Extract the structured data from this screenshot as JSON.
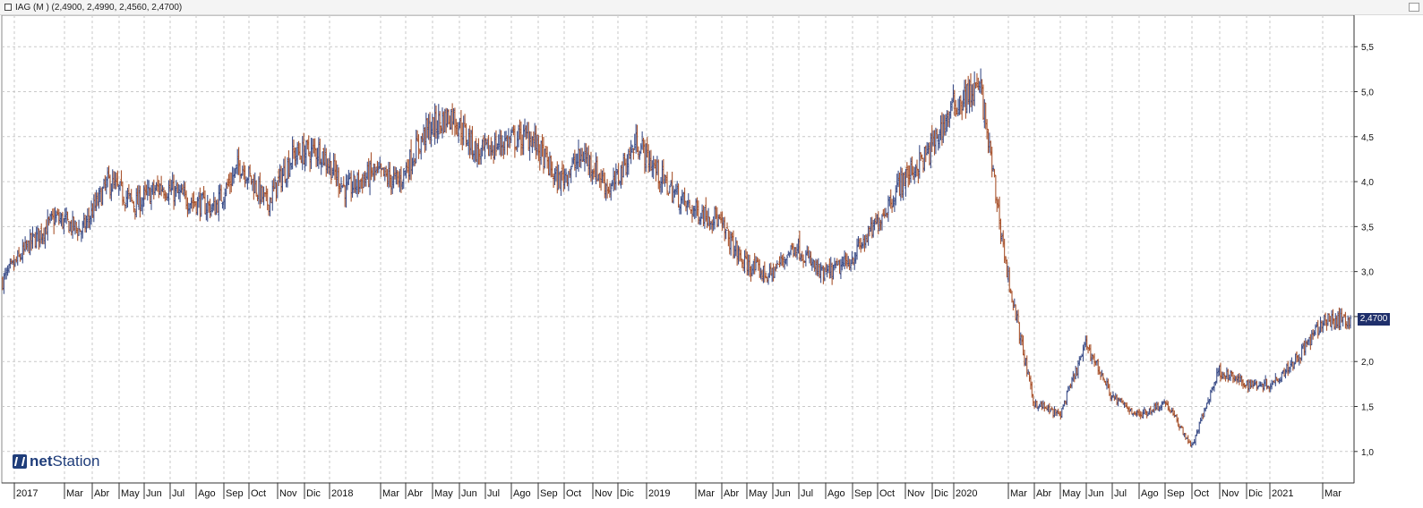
{
  "header": {
    "title": "IAG (M ) (2,4900, 2,4990, 2,4560, 2,4700)"
  },
  "logo": {
    "brand_part1": "net",
    "brand_part2": "Station"
  },
  "price_tag": "2,4700",
  "colors": {
    "up_candle": "#3d4f8a",
    "down_candle": "#a9542e",
    "grid": "#c9c9c9",
    "axis": "#333333",
    "tag_bg": "#1f2f6b"
  },
  "chart_data": {
    "type": "line",
    "style": "bar-ohlc",
    "title": "IAG (M ) (2,4900, 2,4990, 2,4560, 2,4700)",
    "ylim": [
      0.65,
      5.85
    ],
    "yticks": [
      "1,0",
      "1,5",
      "2,0",
      "2,5",
      "3,0",
      "3,5",
      "4,0",
      "4,5",
      "5,0",
      "5,5"
    ],
    "ytick_values": [
      1.0,
      1.5,
      2.0,
      2.5,
      3.0,
      3.5,
      4.0,
      4.5,
      5.0,
      5.5
    ],
    "grid": true,
    "xticks": [
      "2017",
      "Mar",
      "Abr",
      "May",
      "Jun",
      "Jul",
      "Ago",
      "Sep",
      "Oct",
      "Nov",
      "Dic",
      "2018",
      "Mar",
      "Abr",
      "May",
      "Jun",
      "Jul",
      "Ago",
      "Sep",
      "Oct",
      "Nov",
      "Dic",
      "2019",
      "Mar",
      "Abr",
      "May",
      "Jun",
      "Jul",
      "Ago",
      "Sep",
      "Oct",
      "Nov",
      "Dic",
      "2020",
      "Mar",
      "Abr",
      "May",
      "Jun",
      "Jul",
      "Ago",
      "Sep",
      "Oct",
      "Nov",
      "Dic",
      "2021",
      "Mar"
    ],
    "x": [
      "2017-01",
      "2017-02",
      "2017-03",
      "2017-04",
      "2017-05",
      "2017-06",
      "2017-07",
      "2017-08",
      "2017-09",
      "2017-10",
      "2017-11",
      "2017-12",
      "2018-01",
      "2018-02",
      "2018-03",
      "2018-04",
      "2018-05",
      "2018-06",
      "2018-07",
      "2018-08",
      "2018-09",
      "2018-10",
      "2018-11",
      "2018-12",
      "2019-01",
      "2019-02",
      "2019-03",
      "2019-04",
      "2019-05",
      "2019-06",
      "2019-07",
      "2019-08",
      "2019-09",
      "2019-10",
      "2019-11",
      "2019-12",
      "2020-01",
      "2020-02",
      "2020-03",
      "2020-04",
      "2020-05",
      "2020-06",
      "2020-07",
      "2020-08",
      "2020-09",
      "2020-10",
      "2020-11",
      "2020-12",
      "2021-01",
      "2021-02",
      "2021-03",
      "2021-04"
    ],
    "series": [
      {
        "values": [
          2.9,
          3.3,
          3.6,
          3.45,
          4.0,
          3.75,
          3.95,
          3.8,
          3.7,
          4.2,
          3.75,
          4.3,
          4.35,
          3.9,
          4.1,
          4.0,
          4.55,
          4.75,
          4.3,
          4.45,
          4.5,
          4.0,
          4.3,
          3.9,
          4.45,
          4.0,
          3.7,
          3.6,
          3.1,
          2.95,
          3.3,
          2.95,
          3.1,
          3.5,
          4.0,
          4.3,
          4.85,
          5.05,
          3.0,
          1.55,
          1.4,
          2.2,
          1.6,
          1.4,
          1.55,
          1.05,
          1.9,
          1.75,
          1.75,
          2.05,
          2.45,
          2.47
        ]
      }
    ],
    "last_value": 2.47
  }
}
